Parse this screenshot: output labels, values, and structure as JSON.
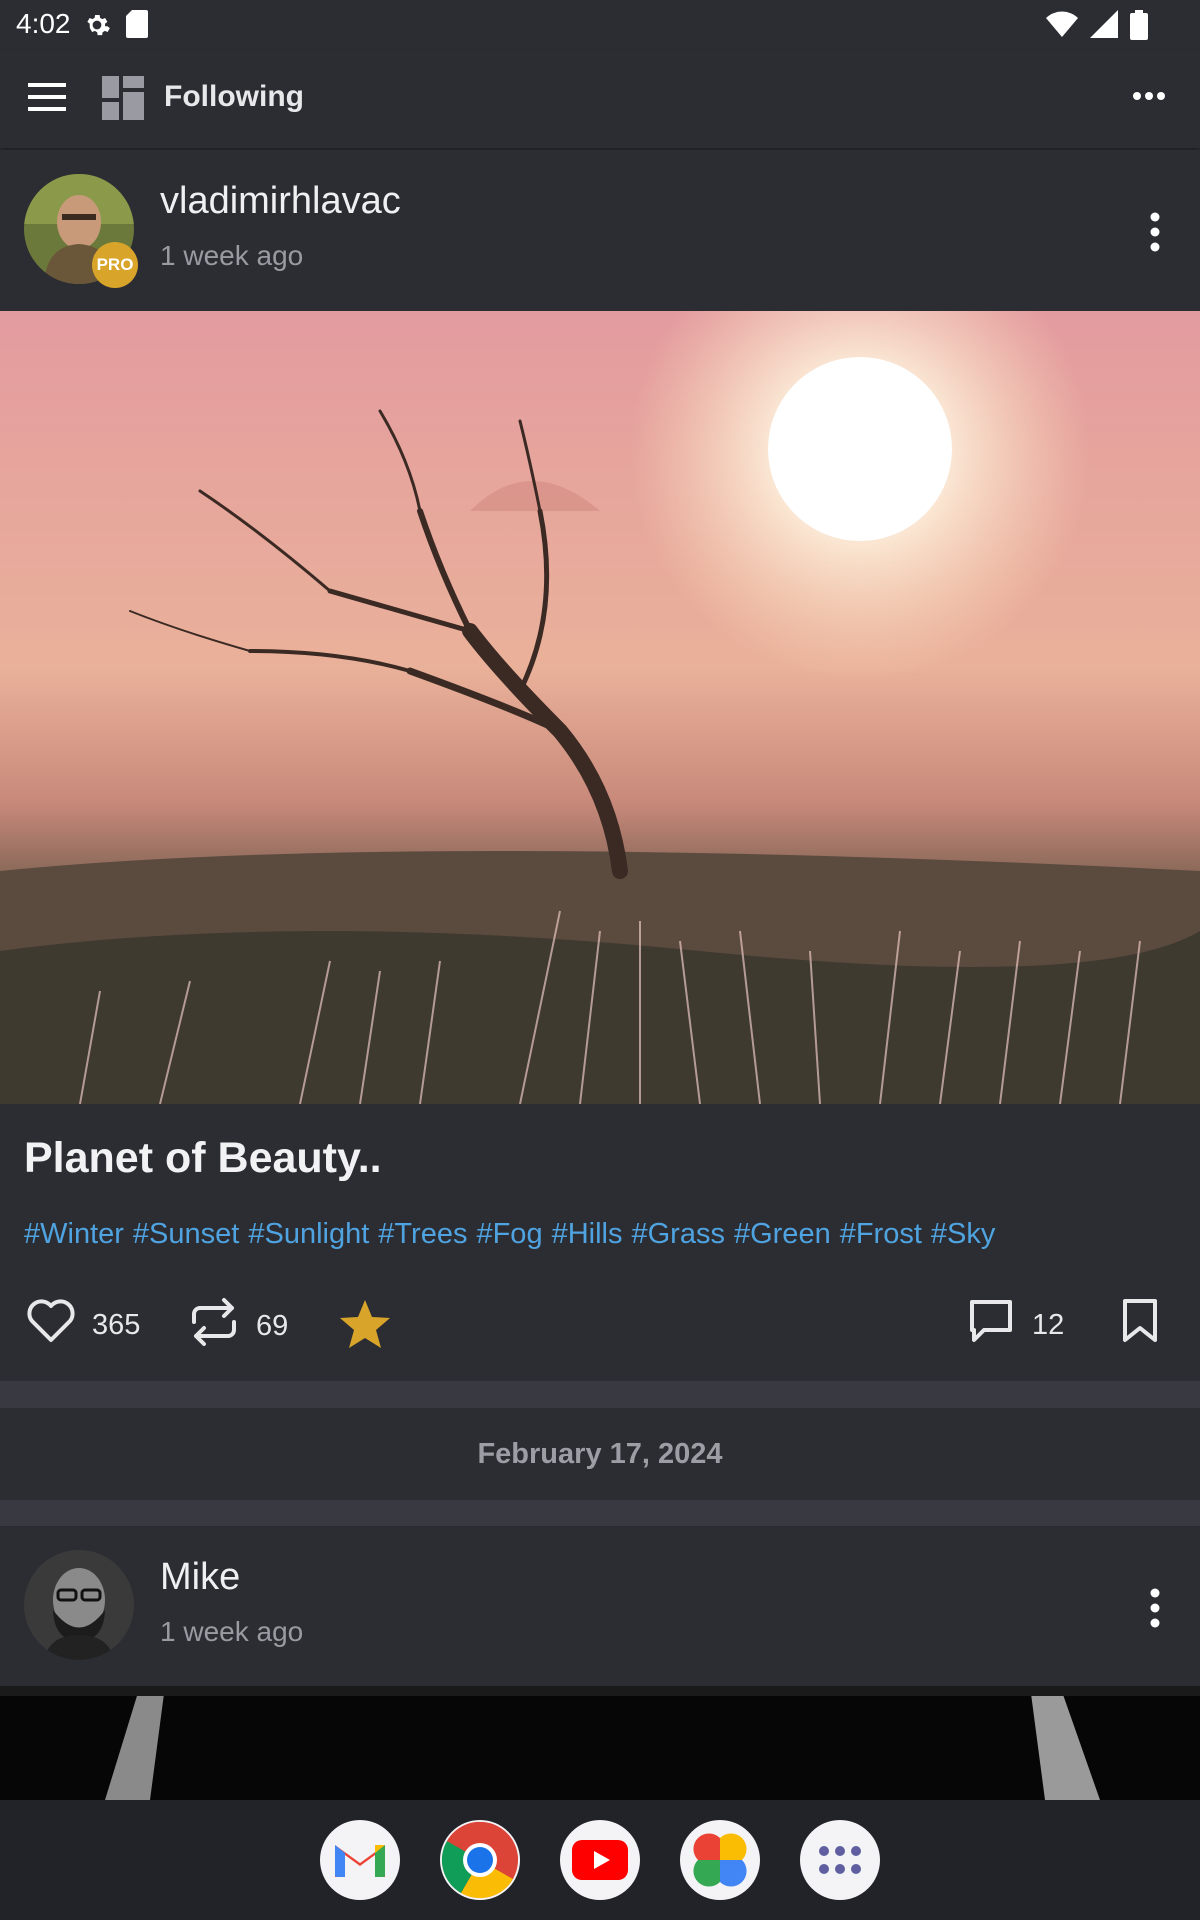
{
  "status": {
    "time": "4:02"
  },
  "appbar": {
    "title": "Following"
  },
  "post1": {
    "username": "vladimirhlavac",
    "badge": "PRO",
    "time_ago": "1 week ago",
    "title": "Planet of Beauty..",
    "tags": [
      "#Winter",
      "#Sunset",
      "#Sunlight",
      "#Trees",
      "#Fog",
      "#Hills",
      "#Grass",
      "#Green",
      "#Frost",
      "#Sky"
    ],
    "likes": "365",
    "reposts": "69",
    "comments": "12"
  },
  "date_separator": "February 17, 2024",
  "post2": {
    "username": "Mike",
    "time_ago": "1 week ago"
  },
  "dock": {
    "apps": [
      "gmail-icon",
      "chrome-icon",
      "youtube-icon",
      "photos-icon",
      "app-drawer-icon"
    ]
  },
  "colors": {
    "background": "#2c2d33",
    "hashtag": "#4fa3e0",
    "star": "#d8a42a",
    "pro_badge": "#d8a42a"
  }
}
